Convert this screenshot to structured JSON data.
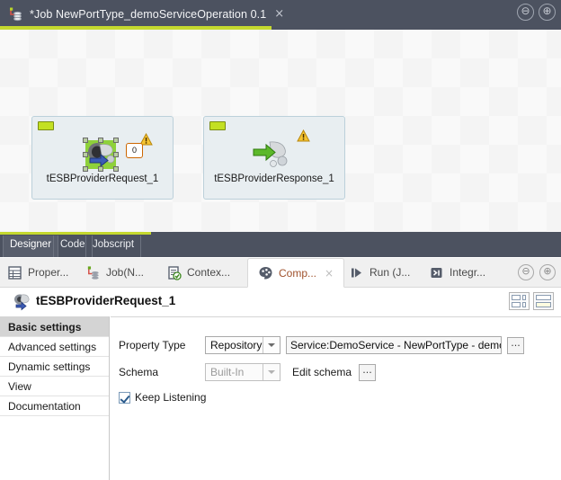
{
  "window": {
    "job_tab": {
      "title": "*Job NewPortType_demoServiceOperation 0.1",
      "icon": "job-icon",
      "close_icon": "×"
    },
    "minimize_icon": "⊖",
    "maximize_icon": "⊕",
    "accent_color": "#c4d82e",
    "chrome_color": "#4c5260"
  },
  "canvas": {
    "nodes": [
      {
        "label": "tESBProviderRequest_1",
        "selected": true,
        "badge": "status-badge",
        "warning_icon": "warning-triangle-icon",
        "connector_badge": "0",
        "icon": "esb-provider-request-icon"
      },
      {
        "label": "tESBProviderResponse_1",
        "selected": false,
        "badge": "status-badge",
        "warning_icon": "warning-triangle-icon",
        "icon": "esb-provider-response-icon"
      }
    ]
  },
  "designer_tabs": [
    {
      "label": "Designer",
      "active": true
    },
    {
      "label": "Code",
      "active": false
    },
    {
      "label": "Jobscript",
      "active": false
    }
  ],
  "panel_tabs": [
    {
      "label": "Proper...",
      "icon": "table-icon",
      "active": false,
      "closable": false
    },
    {
      "label": "Job(N...",
      "icon": "job-icon",
      "active": false,
      "closable": false
    },
    {
      "label": "Contex...",
      "icon": "clipboard-check-icon",
      "active": false,
      "closable": false
    },
    {
      "label": "Comp...",
      "icon": "palette-icon",
      "active": true,
      "closable": true,
      "close_icon": "×"
    },
    {
      "label": "Run (J...",
      "icon": "run-icon",
      "active": false,
      "closable": false
    },
    {
      "label": "Integr...",
      "icon": "integration-icon",
      "active": false,
      "closable": false
    }
  ],
  "panel_controls": {
    "minimize_icon": "⊖",
    "maximize_icon": "⊕"
  },
  "component": {
    "title": "tESBProviderRequest_1",
    "icon": "esb-provider-request-icon",
    "layout_buttons": [
      {
        "name": "grid-layout-button"
      },
      {
        "name": "rows-layout-button"
      }
    ]
  },
  "settings_list": [
    {
      "label": "Basic settings",
      "active": true
    },
    {
      "label": "Advanced settings",
      "active": false
    },
    {
      "label": "Dynamic settings",
      "active": false
    },
    {
      "label": "View",
      "active": false
    },
    {
      "label": "Documentation",
      "active": false
    }
  ],
  "form": {
    "property_type": {
      "label": "Property Type",
      "value": "Repository",
      "disabled": false,
      "repository_value": "Service:DemoService - NewPortType - demo",
      "browse_label": "..."
    },
    "schema": {
      "label": "Schema",
      "value": "Built-In",
      "disabled": true,
      "edit_label": "Edit schema",
      "browse_label": "..."
    },
    "keep_listening": {
      "label": "Keep Listening",
      "checked": true
    }
  }
}
